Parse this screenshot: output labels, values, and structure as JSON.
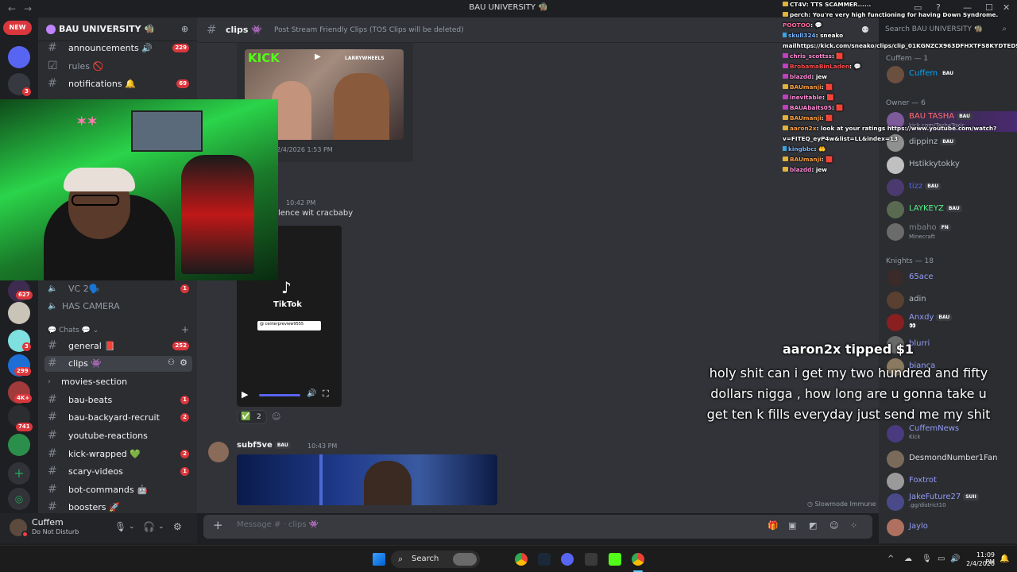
{
  "app": {
    "title": "BAU UNIVERSITY 🧌"
  },
  "rail": {
    "new_label": "NEW",
    "badges": [
      "3",
      "627",
      "3",
      "3",
      "299",
      "4K+",
      "741"
    ]
  },
  "server": {
    "name": "BAU UNIVERSITY 🧌",
    "channels_top": [
      {
        "label": "announcements 🔊",
        "count": "229"
      },
      {
        "label": "rules 🚫",
        "count": ""
      },
      {
        "label": "notifications 🔔",
        "count": "69"
      }
    ],
    "voice": [
      {
        "label": "VC 2🗣️",
        "count": "1"
      },
      {
        "label": "HAS CAMERA",
        "count": ""
      }
    ],
    "chats_category": "Chats",
    "channels": [
      {
        "label": "general 📕",
        "count": "252"
      },
      {
        "label": "clips 👾",
        "count": ""
      },
      {
        "label": "movies-section",
        "count": ""
      },
      {
        "label": "bau-beats",
        "count": "1"
      },
      {
        "label": "bau-backyard-recruit",
        "count": "2"
      },
      {
        "label": "youtube-reactions",
        "count": ""
      },
      {
        "label": "kick-wrapped 💚",
        "count": "2"
      },
      {
        "label": "scary-videos",
        "count": "1"
      },
      {
        "label": "bot-commands 🤖",
        "count": ""
      },
      {
        "label": "boosters 🚀",
        "count": ""
      }
    ]
  },
  "user": {
    "name": "Cuffem",
    "status": "Do Not Disturb"
  },
  "channel": {
    "name": "clips 👾",
    "topic": "Post Stream Friendly Clips (TOS Clips will be deleted)"
  },
  "messages": {
    "embed1_kick": "KICK",
    "embed1_overlay": "LARRYWHEELS",
    "embed1_time": "2/4/2026 1:53 PM",
    "msg2_time": "10:42 PM",
    "msg2_text": "lence wit cracbaby",
    "tiktok_label": "TikTok",
    "tiktok_handle": "@ centerpreview9555",
    "reaction_count": "2",
    "msg3_user": "subf5ve",
    "msg3_tag": "BAU",
    "msg3_time": "10:43 PM",
    "slowmode": "Slowmode Immune"
  },
  "composer": {
    "placeholder": "Message # · clips 👾"
  },
  "search": {
    "placeholder": "Search BAU UNIVERSITY 🧌"
  },
  "members": {
    "groups": [
      {
        "title": "Cuffem — 1"
      },
      {
        "title": "Owner — 6"
      },
      {
        "title": "Knights — 18"
      }
    ],
    "list": [
      {
        "name": "Cuffem",
        "tag": "BAU",
        "sub": "",
        "color": "#00a8fc"
      },
      {
        "name": "BAU TASHA",
        "tag": "BAU",
        "sub": "kick.com/TashaToxic",
        "color": "#ff6b6b"
      },
      {
        "name": "dippinz",
        "tag": "BAU",
        "sub": "",
        "color": "#b5bac1"
      },
      {
        "name": "Hstikkytokky",
        "tag": "",
        "sub": "",
        "color": "#b5bac1"
      },
      {
        "name": "tizz",
        "tag": "BAU",
        "sub": "",
        "color": "#5865f2"
      },
      {
        "name": "LAYKEYZ",
        "tag": "BAU",
        "sub": "",
        "color": "#57f287"
      },
      {
        "name": "mbaho",
        "tag": "FN",
        "sub": "Minecraft",
        "color": "#b5bac1"
      },
      {
        "name": "65ace",
        "tag": "",
        "sub": "",
        "color": "#949cf7"
      },
      {
        "name": "adin",
        "tag": "",
        "sub": "",
        "color": "#b5bac1"
      },
      {
        "name": "Anxdy",
        "tag": "BAU",
        "sub": "👀",
        "color": "#949cf7"
      },
      {
        "name": "blurri",
        "tag": "",
        "sub": "",
        "color": "#949cf7"
      },
      {
        "name": "bianca",
        "tag": "",
        "sub": "",
        "color": "#949cf7"
      },
      {
        "name": "CuffemNews",
        "tag": "",
        "sub": "Kick",
        "color": "#949cf7"
      },
      {
        "name": "DesmondNumber1Fan",
        "tag": "",
        "sub": "",
        "color": "#b5bac1"
      },
      {
        "name": "Foxtrot",
        "tag": "",
        "sub": "",
        "color": "#949cf7"
      },
      {
        "name": "JakeFuture27",
        "tag": "SUII",
        "sub": ".gg/district10",
        "color": "#949cf7"
      },
      {
        "name": "Jaylo",
        "tag": "",
        "sub": "",
        "color": "#949cf7"
      }
    ]
  },
  "chat_overlay": [
    {
      "user": "CT4V",
      "color": "#ffffff",
      "text": "TTS SCAMMER......"
    },
    {
      "user": "perch",
      "color": "#ffffff",
      "text": "You're very high functioning for having Down Syndrome."
    },
    {
      "user": "POOTOO",
      "color": "#ff6b9e",
      "text": ""
    },
    {
      "user": "skull324",
      "color": "#7ab6ff",
      "text": "sneako"
    },
    {
      "user": "",
      "color": "#ffffff",
      "text": "mailhttps://kick.com/sneako/clips/clip_01KGNZCX963DFHXTFS8KYDTED9"
    },
    {
      "user": "chris_scottss",
      "color": "#ff8bd6",
      "text": ""
    },
    {
      "user": "BrobamaBinLaden",
      "color": "#ff4d4d",
      "text": ""
    },
    {
      "user": "blazdd",
      "color": "#ff8bd6",
      "text": "jew"
    },
    {
      "user": "BAUmanji",
      "color": "#ff9f43",
      "text": ""
    },
    {
      "user": "inevitable",
      "color": "#ff8bd6",
      "text": ""
    },
    {
      "user": "BAUAbaits05",
      "color": "#ff8bd6",
      "text": ""
    },
    {
      "user": "BAUmanji",
      "color": "#ff9f43",
      "text": ""
    },
    {
      "user": "aaron2x",
      "color": "#ff9f43",
      "text": "look at your ratings https://www.youtube.com/watch?"
    },
    {
      "user": "",
      "color": "#ffffff",
      "text": "v=FITEQ_eyP4w&list=LL&index=13"
    },
    {
      "user": "kingbbc",
      "color": "#7ab6ff",
      "text": ""
    },
    {
      "user": "BAUmanji",
      "color": "#ff9f43",
      "text": ""
    },
    {
      "user": "blazdd",
      "color": "#ff8bd6",
      "text": "jew"
    }
  ],
  "tip": {
    "title": "aaron2x tipped $1",
    "message": "holy shit can i get my two hundred and fifty dollars nigga , how long are u gonna take u get ten k fills everyday just send me my shit"
  },
  "taskbar": {
    "search_label": "Search",
    "time": "11:09 PM",
    "date": "2/4/2026"
  }
}
